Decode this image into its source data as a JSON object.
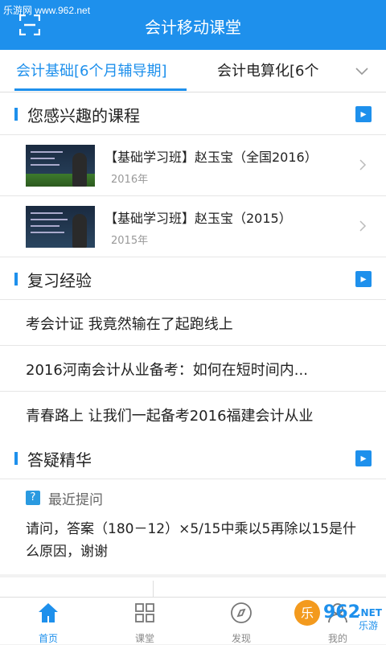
{
  "watermark": "乐游网 www.962.net",
  "header": {
    "title": "会计移动课堂",
    "scan_icon": "scan-icon"
  },
  "tabs": [
    {
      "label": "会计基础[6个月辅导期]",
      "active": true
    },
    {
      "label": "会计电算化[6个",
      "active": false
    }
  ],
  "sections": {
    "courses": {
      "title": "您感兴趣的课程",
      "items": [
        {
          "title": "【基础学习班】赵玉宝（全国2016）",
          "year": "2016年"
        },
        {
          "title": "【基础学习班】赵玉宝（2015）",
          "year": "2015年"
        }
      ]
    },
    "review": {
      "title": "复习经验",
      "items": [
        "考会计证 我竟然输在了起跑线上",
        "2016河南会计从业备考：如何在短时间内...",
        "青春路上 让我们一起备考2016福建会计从业"
      ]
    },
    "qa": {
      "title": "答疑精华",
      "badge": "?",
      "label": "最近提问",
      "question": "请问，答案（180－12）×5/15中乘以5再除以15是什么原因，谢谢"
    }
  },
  "tabbar": [
    {
      "label": "首页",
      "icon": "home-icon",
      "active": true
    },
    {
      "label": "课堂",
      "icon": "grid-icon",
      "active": false
    },
    {
      "label": "发现",
      "icon": "compass-icon",
      "active": false
    },
    {
      "label": "我的",
      "icon": "user-icon",
      "active": false
    }
  ],
  "colors": {
    "accent": "#1e90ec"
  }
}
